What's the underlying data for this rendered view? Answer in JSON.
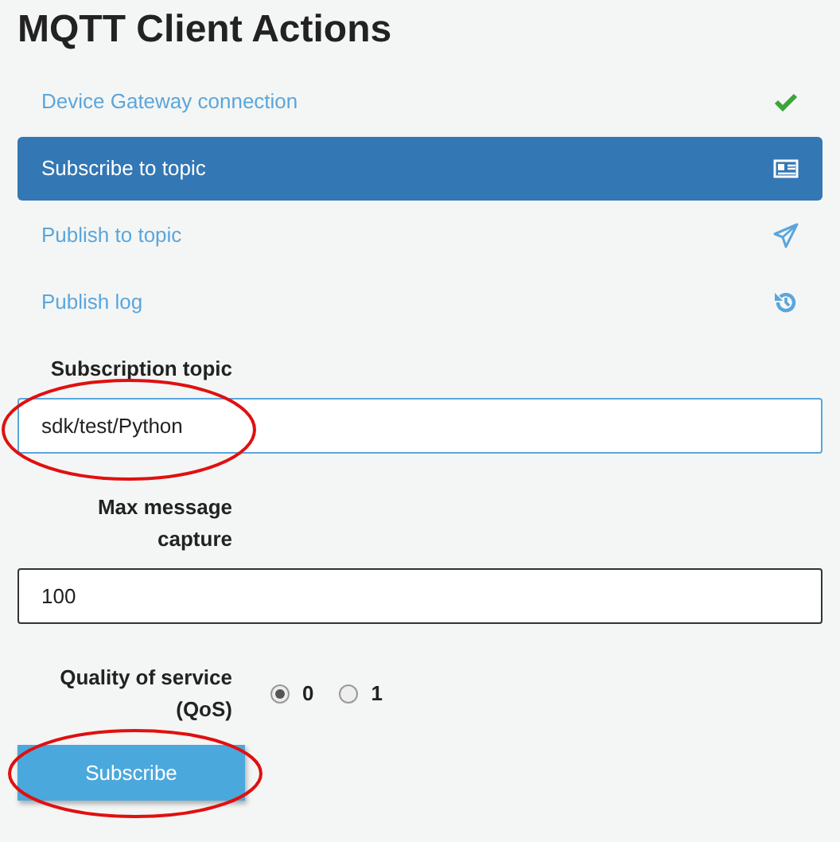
{
  "title": "MQTT Client Actions",
  "menu": [
    {
      "label": "Device Gateway connection",
      "selected": false,
      "kind": "check"
    },
    {
      "label": "Subscribe to topic",
      "selected": true,
      "kind": "newspaper"
    },
    {
      "label": "Publish to topic",
      "selected": false,
      "kind": "send"
    },
    {
      "label": "Publish log",
      "selected": false,
      "kind": "history"
    }
  ],
  "form": {
    "topic": {
      "label": "Subscription topic",
      "value": "sdk/test/Python",
      "focused": true,
      "highlighted": true
    },
    "max_capture": {
      "label": "Max message capture",
      "value": "100",
      "focused": false
    },
    "qos": {
      "label": "Quality of service (QoS)",
      "options": [
        {
          "label": "0",
          "selected": true
        },
        {
          "label": "1",
          "selected": false
        }
      ]
    },
    "button": {
      "label": "Subscribe",
      "highlighted": true
    }
  }
}
